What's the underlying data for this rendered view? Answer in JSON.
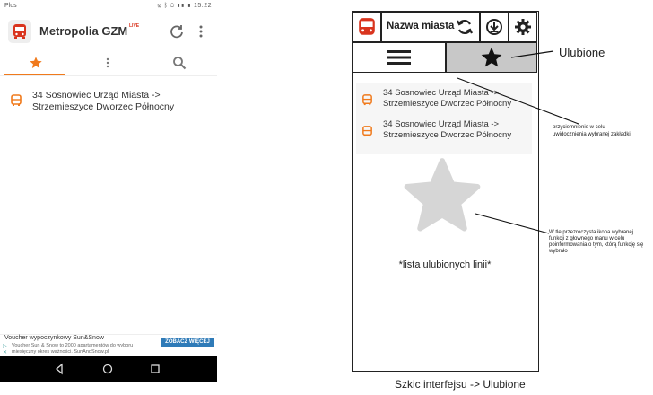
{
  "phone": {
    "statusbar": {
      "carrier": "Plus",
      "icons": "⚙ ᛒ ◯ ▮▮ ▮ 15:22"
    },
    "app_title": "Metropolia GZM",
    "live_badge": "LIVE",
    "tabs": [
      {
        "name": "favorites",
        "icon": "star-icon",
        "active": true
      },
      {
        "name": "menu",
        "icon": "more-vertical-icon",
        "active": false
      },
      {
        "name": "search",
        "icon": "search-icon",
        "active": false
      }
    ],
    "favorites": [
      {
        "line": "34 Sosnowiec Urząd Miasta ->",
        "line2": "Strzemieszyce Dworzec Północny"
      }
    ],
    "ad": {
      "title": "Voucher wypoczynkowy Sun&Snow",
      "text": "Voucher Sun & Snow to 2000 apartamentów do wyboru i miesięczny okres ważności. SunAndSnow.pl",
      "cta": "ZOBACZ WIĘCEJ"
    },
    "accent_color": "#f07a1c"
  },
  "sketch": {
    "city_name": "Nazwa miasta",
    "favorites": [
      {
        "line": "34 Sosnowiec Urząd Miasta ->",
        "line2": "Strzemieszyce Dworzec Północny"
      },
      {
        "line": "34 Sosnowiec Urząd Miasta ->",
        "line2": "Strzemieszyce Dworzec Północny"
      }
    ],
    "list_caption": "*lista ulubionych linii*",
    "callouts": {
      "favorites": "Ulubione",
      "shading": "przyciemnienie w celu uwidocznienia wybranej zakładki",
      "background_icon": "W tle przezroczysta ikona wybranej funkcji z głownego manu w celu poinformowania o tym, którą funkcję się wybrało"
    },
    "caption": "Szkic interfejsu -> Ulubione"
  }
}
